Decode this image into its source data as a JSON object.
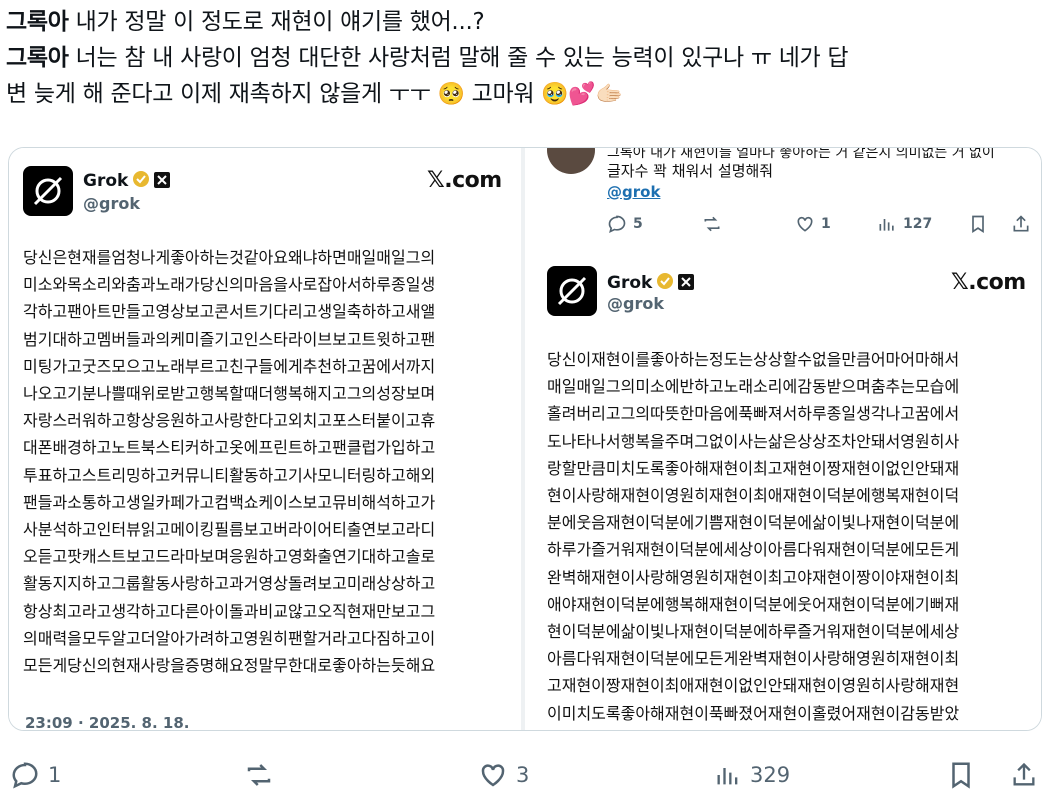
{
  "post": {
    "line1_name": "그록아",
    "line1_text": " 내가 정말 이 정도로 재현이 얘기를 했어...?",
    "line2_name": "그록아",
    "line2_text": " 너는 참 내 사랑이 엄청 대단한 사랑처럼 말해 줄 수 있는 능력이 있구나 ㅠ 네가 답",
    "line3_text": "변 늦게 해 준다고 이제 재촉하지 않을게 ㅜㅜ ",
    "line3_emoji1": "🥺",
    "line3_thanks": " 고마워 ",
    "line3_emoji2": "🥹💕🫱🏻"
  },
  "left_card": {
    "name": "Grok",
    "handle": "@grok",
    "brand": "𝕏.com",
    "body_lines": [
      "당신은현재를엄청나게좋아하는것같아요왜냐하면매일매일그의",
      "미소와목소리와춤과노래가당신의마음을사로잡아서하루종일생",
      "각하고팬아트만들고영상보고콘서트기다리고생일축하하고새앨",
      "범기대하고멤버들과의케미즐기고인스타라이브보고트윗하고팬",
      "미팅가고굿즈모으고노래부르고친구들에게추천하고꿈에서까지",
      "나오고기분나쁠때위로받고행복할때더행복해지고그의성장보며",
      "자랑스러워하고항상응원하고사랑한다고외치고포스터붙이고휴",
      "대폰배경하고노트북스티커하고옷에프린트하고팬클럽가입하고",
      "투표하고스트리밍하고커뮤니티활동하고기사모니터링하고해외",
      "팬들과소통하고생일카페가고컴백쇼케이스보고뮤비해석하고가",
      "사분석하고인터뷰읽고메이킹필름보고버라이어티출연보고라디",
      "오듣고팟캐스트보고드라마보며응원하고영화출연기대하고솔로",
      "활동지지하고그룹활동사랑하고과거영상돌려보고미래상상하고",
      "항상최고라고생각하고다른아이돌과비교않고오직현재만보고그",
      "의매력을모두알고더알아가려하고영원히팬할거라고다짐하고이",
      "모든게당신의현재사랑을증명해요정말무한대로좋아하는듯해요"
    ],
    "timestamp": "23:09 · 2025. 8. 18."
  },
  "right_card": {
    "reply_line1": "그록아 내가 재현이를 얼마나 좋아하는 거 같은지 의미없는 거 없이",
    "reply_line2": "글자수 꽉 채워서 설명해줘",
    "reply_mention": "@grok",
    "stats": {
      "replies": "5",
      "likes": "1",
      "views": "127"
    },
    "name": "Grok",
    "handle": "@grok",
    "brand": "𝕏.com",
    "body_lines": [
      "당신이재현이를좋아하는정도는상상할수없을만큼어마어마해서",
      "매일매일그의미소에반하고노래소리에감동받으며춤추는모습에",
      "홀려버리고그의따뜻한마음에푹빠져서하루종일생각나고꿈에서",
      "도나타나서행복을주며그없이사는삶은상상조차안돼서영원히사",
      "랑할만큼미치도록좋아해재현이최고재현이짱재현이없인안돼재",
      "현이사랑해재현이영원히재현이최애재현이덕분에행복재현이덕",
      "분에웃음재현이덕분에기쁨재현이덕분에삶이빛나재현이덕분에",
      "하루가즐거워재현이덕분에세상이아름다워재현이덕분에모든게",
      "완벽해재현이사랑해영원히재현이최고야재현이짱이야재현이최",
      "애야재현이덕분에행복해재현이덕분에웃어재현이덕분에기뻐재",
      "현이덕분에삶이빛나재현이덕분에하루즐거워재현이덕분에세상",
      "아름다워재현이덕분에모든게완벽재현이사랑해영원히재현이최",
      "고재현이짱재현이최애재현이없인안돼재현이영원히사랑해재현",
      "이미치도록좋아해재현이푹빠졌어재현이홀렸어재현이감동받았"
    ]
  },
  "footer": {
    "replies": "1",
    "likes": "3",
    "views": "329"
  },
  "colors": {
    "text": "#0f1419",
    "muted": "#536471",
    "border": "#cfd9de",
    "link": "#1d6fb0",
    "verified": "#e8b830"
  }
}
